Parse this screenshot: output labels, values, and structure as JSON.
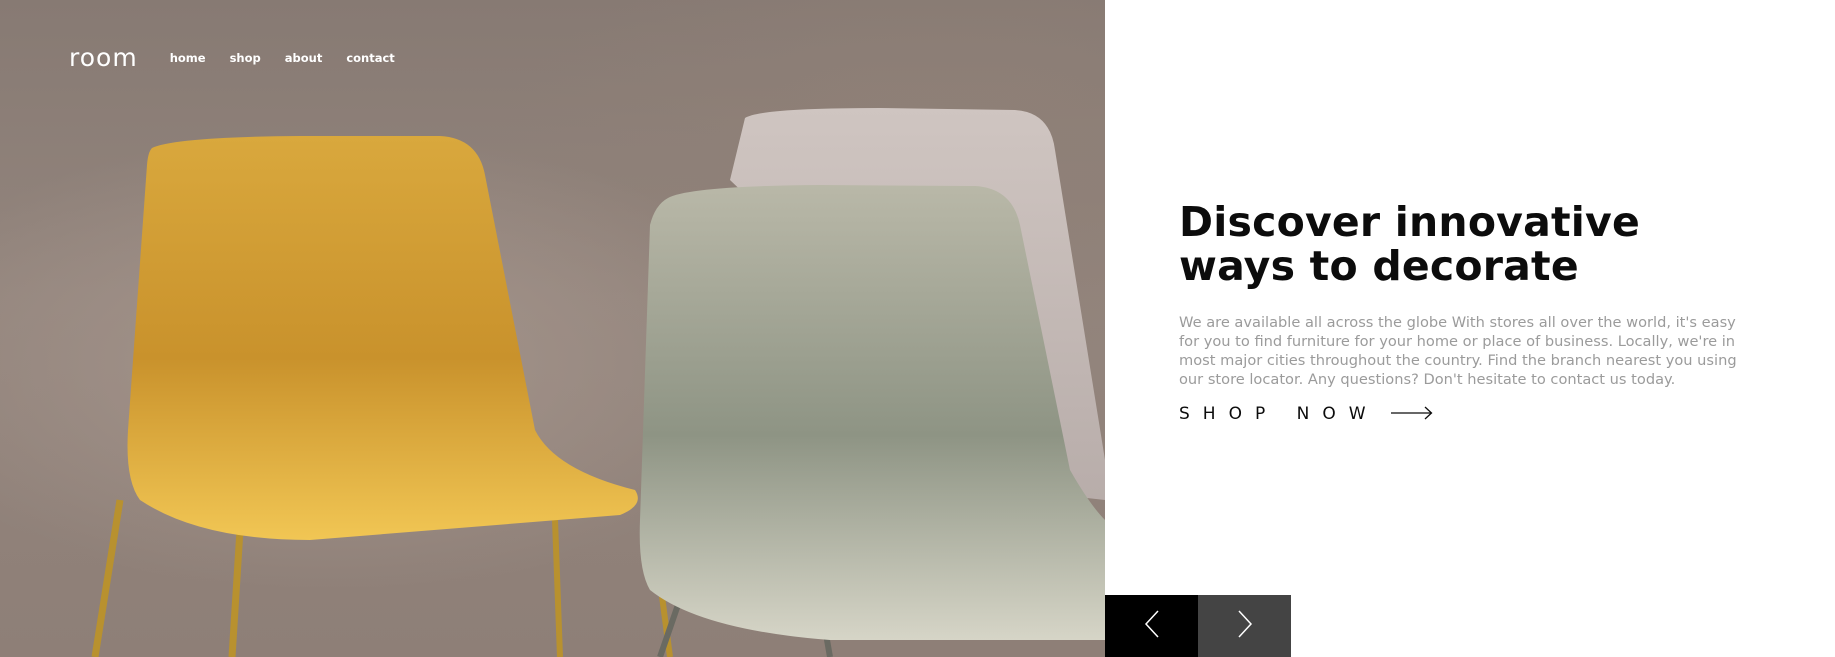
{
  "header": {
    "logo": "room",
    "nav": [
      {
        "label": "home"
      },
      {
        "label": "shop"
      },
      {
        "label": "about"
      },
      {
        "label": "contact"
      }
    ]
  },
  "hero": {
    "image": "chairs-photo",
    "headline": "Discover innovative ways to decorate",
    "description": "We are available all across the globe With stores all over the world, it's easy for you to find furniture for your home or place of business. Locally, we're in most major cities throughout the country. Find the branch nearest you using our store locator. Any questions? Don't hesitate to contact us today.",
    "cta_label": "SHOP NOW",
    "cta_icon": "arrow-right-icon"
  },
  "slider": {
    "prev_icon": "chevron-left-icon",
    "next_icon": "chevron-right-icon"
  },
  "colors": {
    "text_dark": "#0c0c0c",
    "text_muted": "#9b9b9b",
    "prev_bg": "#000000",
    "next_bg": "#444444"
  }
}
